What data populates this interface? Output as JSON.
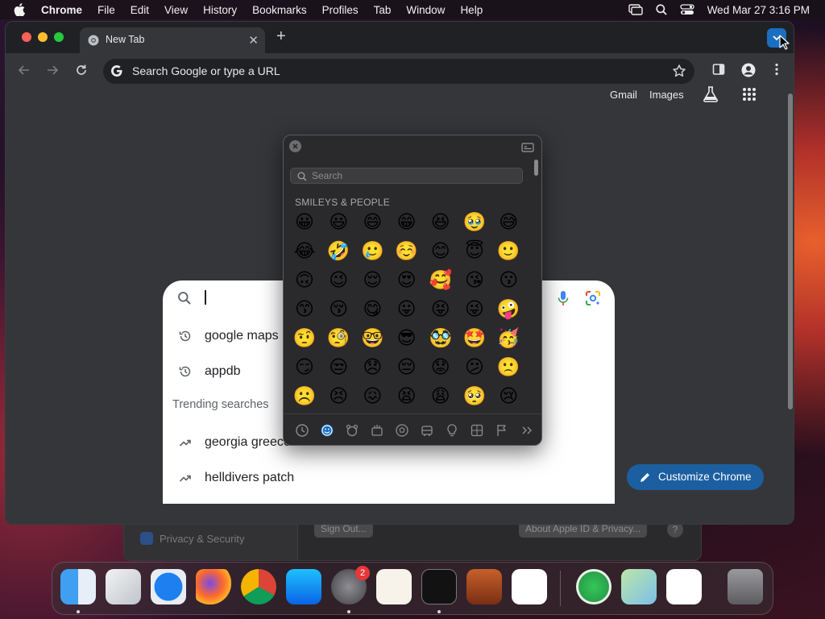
{
  "menubar": {
    "apple_icon": "apple-logo",
    "app_name": "Chrome",
    "menus": [
      "File",
      "Edit",
      "View",
      "History",
      "Bookmarks",
      "Profiles",
      "Tab",
      "Window",
      "Help"
    ],
    "datetime": "Wed Mar 27  3:16 PM"
  },
  "background_window": {
    "sidebar_item": "Privacy & Security",
    "sign_out": "Sign Out...",
    "about": "About Apple ID & Privacy...",
    "help": "?"
  },
  "browser": {
    "tab_title": "New Tab",
    "new_tab": "+",
    "omnibox_placeholder": "Search Google or type a URL",
    "gmail_link": "Gmail",
    "images_link": "Images",
    "customize_button": "Customize Chrome"
  },
  "search_dropdown": {
    "input_value": "",
    "history": [
      "google maps",
      "appdb"
    ],
    "trending_heading": "Trending searches",
    "trending": [
      "georgia greece football live stream",
      "helldivers patch"
    ]
  },
  "emoji_picker": {
    "search_placeholder": "Search",
    "section_title": "SMILEYS & PEOPLE",
    "rows": [
      [
        "😀",
        "😃",
        "😄",
        "😁",
        "😆",
        "🥹",
        "😅"
      ],
      [
        "😂",
        "🤣",
        "🥲",
        "☺️",
        "😊",
        "😇",
        "🙂"
      ],
      [
        "🙃",
        "😉",
        "😌",
        "😍",
        "🥰",
        "😘",
        "😗"
      ],
      [
        "😙",
        "😚",
        "😋",
        "😛",
        "😝",
        "😜",
        "🤪"
      ],
      [
        "🤨",
        "🧐",
        "🤓",
        "😎",
        "🥸",
        "🤩",
        "🥳"
      ],
      [
        "😏",
        "😒",
        "😞",
        "😔",
        "😟",
        "😕",
        "🙁"
      ],
      [
        "☹️",
        "😣",
        "😖",
        "😫",
        "😩",
        "🥺",
        "😢"
      ]
    ],
    "categories": [
      "clock-icon",
      "smiley-icon",
      "animal-icon",
      "food-icon",
      "ball-icon",
      "car-icon",
      "bulb-icon",
      "symbols-icon",
      "flag-icon",
      "more-icon"
    ]
  },
  "dock": {
    "apps": [
      "Finder",
      "Launchpad",
      "Safari",
      "Firefox",
      "Google Chrome",
      "App Store",
      "System Settings",
      "TextEdit",
      "Terminal",
      "GarageBand",
      "Visual Studio Code",
      "Find My",
      "Maps",
      "QQL",
      "Trash"
    ],
    "settings_badge": "2"
  },
  "colors": {
    "accent": "#1a6fc0",
    "window_bg": "#35363a",
    "titlebar_bg": "#202124"
  }
}
